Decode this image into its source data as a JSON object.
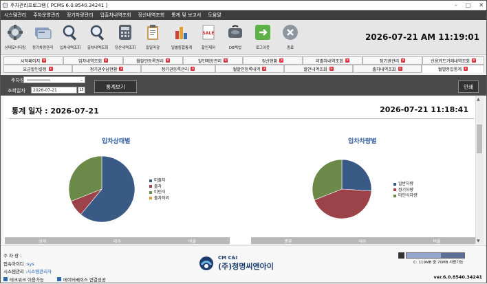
{
  "window": {
    "title": "주차관리프로그램 [ PCMS 6.0.8540.34241 ]"
  },
  "menu": [
    "시스템관리",
    "주차운영관리",
    "정기차량관리",
    "입출차내역조회",
    "정산내역조회",
    "통계 및 보고서",
    "도움말"
  ],
  "toolbar": [
    {
      "label": "상태모니터링",
      "icon": "monitor-icon"
    },
    {
      "label": "정기차량관리",
      "icon": "card-icon"
    },
    {
      "label": "입차내역조회",
      "icon": "magnifier-icon"
    },
    {
      "label": "출차내역조회",
      "icon": "magnifier-icon"
    },
    {
      "label": "정산내역조회",
      "icon": "calculator-icon"
    },
    {
      "label": "일일마감",
      "icon": "clipboard-icon"
    },
    {
      "label": "일별종합통계",
      "icon": "bar-chart-icon"
    },
    {
      "label": "할인제어",
      "icon": "sale-icon"
    },
    {
      "label": "DB백업",
      "icon": "database-icon"
    },
    {
      "label": "로그아웃",
      "icon": "logout-icon"
    },
    {
      "label": "종료",
      "icon": "close-icon"
    }
  ],
  "clock": "2026-07-21 AM 11:19:01",
  "tabs_row1": [
    "시작페이지",
    "입차내역조회",
    "월할인등록관리",
    "할인매장관리",
    "정산현황",
    "미출차내역조회",
    "정기권관리",
    "신용카드거래내역조회"
  ],
  "tabs_row2": [
    "요금할인설정",
    "정기권수납현황",
    "정기권등록관리",
    "월할인등록내역",
    "할인내역조회",
    "출차내역조회",
    "월별종합통계"
  ],
  "filter": {
    "parking_label": "주차장",
    "parking_value": "",
    "date_label": "조회일자",
    "date_value": "2026-07-21",
    "stat_button": "통계보기",
    "print_button": "인쇄"
  },
  "stats": {
    "date_caption": "통계 일자 : 2026-07-21",
    "datetime": "2026-07-21 11:18:41"
  },
  "chart_data": [
    {
      "type": "pie",
      "title": "입차상태별",
      "categories": [
        "미출차",
        "출차",
        "미인식",
        "출차처리"
      ],
      "values": [
        61,
        8,
        31,
        0
      ],
      "colors": [
        "#3a5a86",
        "#9c4349",
        "#6b8a4a",
        "#e39b33"
      ],
      "table_headers": [
        "상태",
        "대수",
        "비율"
      ]
    },
    {
      "type": "pie",
      "title": "입차차량별",
      "categories": [
        "일반차량",
        "정기차량",
        "미인식차량"
      ],
      "values": [
        26,
        43,
        31
      ],
      "colors": [
        "#3a5a86",
        "#9c4349",
        "#6b8a4a"
      ],
      "table_headers": [
        "종류",
        "대수",
        "비율"
      ]
    }
  ],
  "footer": {
    "parking_label": "주 차 장 :",
    "parking_value": "",
    "user_label": "접속아이디 :",
    "user_value": "sys",
    "sysmgr_label": "시스템관리 :",
    "sysmgr_value": "시스템관리자",
    "status1": "테크워크 이용가능",
    "status2": "데이터베이스 연결성공",
    "logo_small": "CM C&I",
    "logo_big": "(주)청명씨앤아이",
    "disk_text": "C: 119MB 중 70MB 사용가능",
    "disk_free_fraction": 0.59,
    "version": "ver.6.0.8540.34241"
  }
}
